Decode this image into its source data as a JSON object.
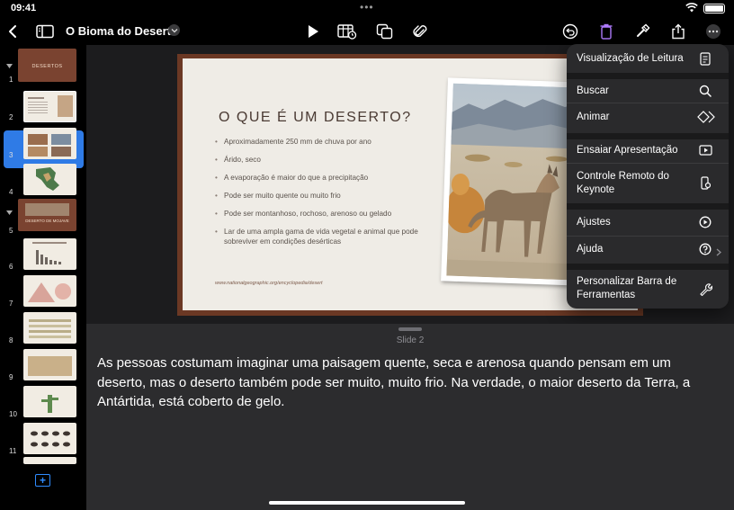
{
  "status_bar": {
    "time": "09:41"
  },
  "toolbar": {
    "title": "O Bioma do Deserto",
    "icons": [
      "back-icon",
      "sidebar-icon",
      "play-icon",
      "table-icon",
      "shapes-icon",
      "attachment-icon",
      "undo-icon",
      "trash-icon",
      "format-brush-icon",
      "share-icon",
      "more-icon"
    ]
  },
  "sidebar": {
    "slides": [
      {
        "num": "1",
        "label": "DESERTOS"
      },
      {
        "num": "2",
        "label": ""
      },
      {
        "num": "3",
        "label": ""
      },
      {
        "num": "4",
        "label": ""
      },
      {
        "num": "5",
        "label": "DESERTO DE MOJAVE"
      },
      {
        "num": "6",
        "label": ""
      },
      {
        "num": "7",
        "label": ""
      },
      {
        "num": "8",
        "label": ""
      },
      {
        "num": "9",
        "label": ""
      },
      {
        "num": "10",
        "label": ""
      },
      {
        "num": "11",
        "label": ""
      }
    ],
    "selected": "2",
    "add_label": "+"
  },
  "slide": {
    "title": "O QUE É UM DESERTO?",
    "bullets": [
      "Aproximadamente 250 mm de chuva por ano",
      "Árido, seco",
      "A evaporação é maior do que a precipitação",
      "Pode ser muito quente ou muito frio",
      "Pode ser montanhoso, rochoso, arenoso ou gelado",
      "Lar de uma ampla gama de vida vegetal e animal que pode sobreviver em condições desérticas"
    ],
    "source": "www.nationalgeographic.org/encyclopedia/desert"
  },
  "menu": {
    "items": [
      {
        "label": "Visualização de Leitura",
        "icon": "reading-view-icon"
      },
      {
        "label": "Buscar",
        "icon": "search-icon"
      },
      {
        "label": "Animar",
        "icon": "animate-icon"
      },
      {
        "label": "Ensaiar Apresentação",
        "icon": "rehearse-icon"
      },
      {
        "label": "Controle Remoto do Keynote",
        "icon": "remote-icon"
      },
      {
        "label": "Ajustes",
        "icon": "settings-icon"
      },
      {
        "label": "Ajuda",
        "icon": "help-icon"
      },
      {
        "label": "Personalizar Barra de Ferramentas",
        "icon": "wrench-icon"
      }
    ]
  },
  "notes": {
    "slide_label": "Slide 2",
    "text": "As pessoas costumam imaginar uma paisagem quente, seca e arenosa quando pensam em um deserto, mas o deserto também pode ser muito, muito frio. Na verdade, o maior deserto da Terra, a Antártida, está coberto de gelo."
  },
  "colors": {
    "accent": "#2f7be6",
    "slide_frame": "#6b3824",
    "menu_bg": "#2a2a2c"
  }
}
